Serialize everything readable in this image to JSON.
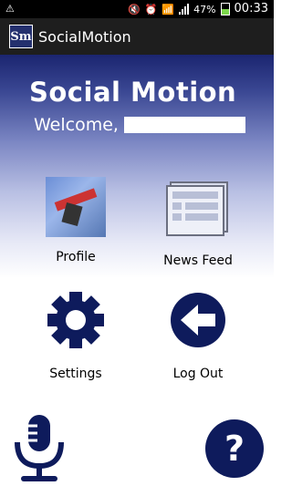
{
  "status_bar": {
    "battery": "47%",
    "time": "00:33"
  },
  "action_bar": {
    "logo_text": "Sm",
    "title": "SocialMotion"
  },
  "header": {
    "brand": "Social Motion",
    "welcome": "Welcome,"
  },
  "tiles": [
    {
      "label": "Profile"
    },
    {
      "label": "News Feed"
    },
    {
      "label": "Settings"
    },
    {
      "label": "Log Out"
    }
  ],
  "help": {
    "symbol": "?"
  },
  "colors": {
    "primary": "#0e1b5c",
    "header_top": "#1b2570"
  }
}
